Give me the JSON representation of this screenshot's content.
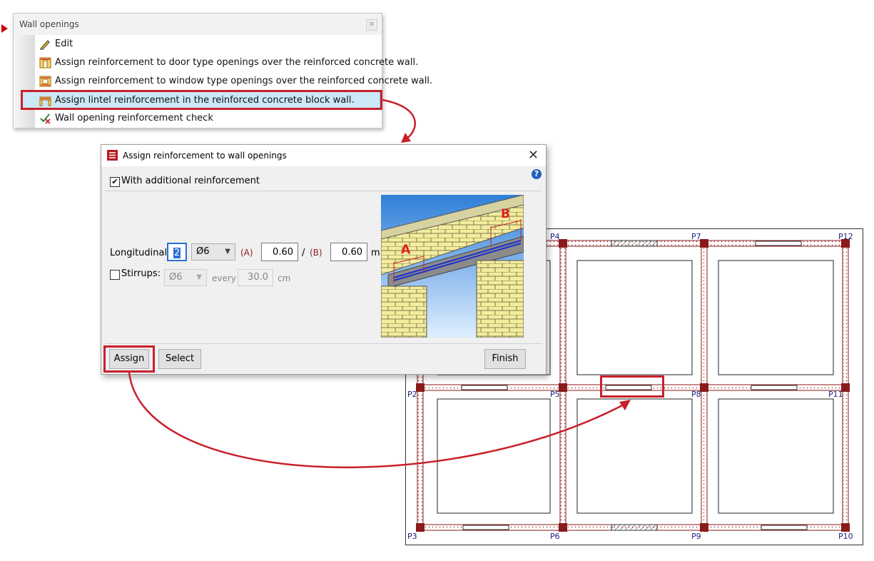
{
  "menu": {
    "title": "Wall openings",
    "pin_glyph": "¤",
    "items": [
      {
        "label": "Edit",
        "icon": "pencil-icon"
      },
      {
        "label": "Assign reinforcement to door type openings over the reinforced concrete wall.",
        "icon": "door-reinforcement-icon"
      },
      {
        "label": "Assign reinforcement to window type openings over the reinforced concrete wall.",
        "icon": "window-reinforcement-icon"
      },
      {
        "label": "Assign lintel reinforcement in the reinforced concrete block wall.",
        "icon": "lintel-reinforcement-icon"
      },
      {
        "label": "Wall opening reinforcement check",
        "icon": "check-icon"
      }
    ]
  },
  "dialog": {
    "title": "Assign reinforcement to wall openings",
    "close_glyph": "✕",
    "help_glyph": "?",
    "additional_reinforcement": {
      "label": "With additional reinforcement",
      "checked": true
    },
    "longitudinal": {
      "label": "Longitudinal:",
      "count": "2",
      "diameter": "Ø6",
      "a_label": "(A)",
      "a_value": "0.60",
      "separator": "/",
      "b_label": "(B)",
      "b_value": "0.60",
      "unit": "m"
    },
    "stirrups": {
      "label": "Stirrups:",
      "checked": false,
      "diameter": "Ø6",
      "every_label": "every",
      "spacing": "30.0",
      "unit": "cm"
    },
    "illustration": {
      "a_tag": "A",
      "b_tag": "B"
    },
    "buttons": {
      "assign": "Assign",
      "select": "Select",
      "finish": "Finish"
    }
  },
  "plan": {
    "labels": [
      "P4",
      "P7",
      "P12",
      "P2",
      "P5",
      "P8",
      "P11",
      "P3",
      "P6",
      "P9",
      "P10"
    ]
  },
  "colors": {
    "highlight": "#c8202a",
    "label": "#1a237e",
    "wall": "#8b1a1a"
  }
}
